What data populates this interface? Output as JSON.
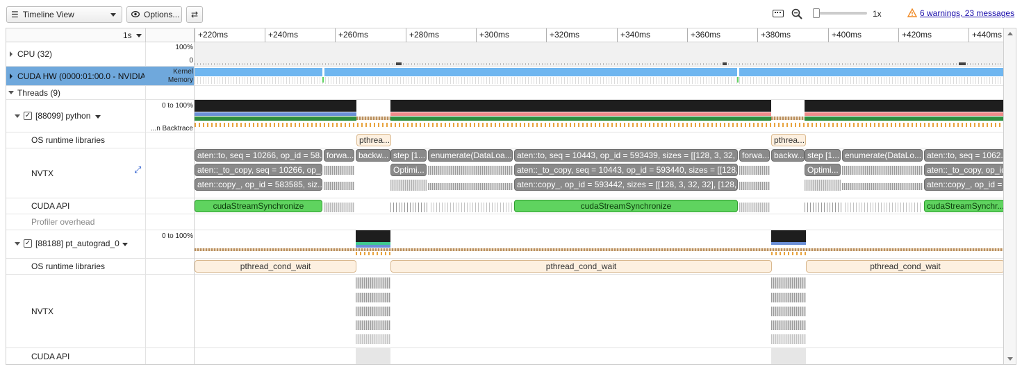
{
  "toolbar": {
    "view_select": "Timeline View",
    "options_label": "Options...",
    "swap_glyph": "⇄",
    "zoom_level": "1x",
    "warnings_link": "6 warnings, 23 messages"
  },
  "zoom_slider": {
    "value_fraction": 0.0
  },
  "timeline": {
    "scale_label": "1s",
    "ticks": [
      "+220ms",
      "+240ms",
      "+260ms",
      "+280ms",
      "+300ms",
      "+320ms",
      "+340ms",
      "+360ms",
      "+380ms",
      "+400ms",
      "+420ms",
      "+440ms"
    ]
  },
  "rows": {
    "cpu": {
      "label": "CPU (32)",
      "max": "100%",
      "min": "0"
    },
    "cuda_hw": {
      "label": "CUDA HW (0000:01:00.0 - NVIDIA (",
      "kernel": "Kernel",
      "memory": "Memory"
    },
    "threads": {
      "label": "Threads (9)"
    },
    "python": {
      "label": "[88099] python",
      "range": "0 to 100%",
      "backtrace": "...n Backtrace"
    },
    "python_os": {
      "label": "OS runtime libraries"
    },
    "python_nvtx": {
      "label": "NVTX"
    },
    "python_cuda": {
      "label": "CUDA API"
    },
    "profiler": {
      "label": "Profiler overhead"
    },
    "autograd": {
      "label": "[88188] pt_autograd_0",
      "range": "0 to 100%"
    },
    "autograd_os": {
      "label": "OS runtime libraries"
    },
    "autograd_nvtx": {
      "label": "NVTX"
    },
    "autograd_cuda": {
      "label": "CUDA API"
    }
  },
  "events": {
    "os_python": [
      "pthrea...",
      "pthrea..."
    ],
    "nvtx_row1": [
      "aten::to, seq = 10266, op_id = 58...",
      "forwa...",
      "backw...",
      "step [1...",
      "enumerate(DataLoa...",
      "aten::to, seq = 10443, op_id = 593439, sizes = [[128, 3, 32, ...",
      "forwa...",
      "backw...",
      "step [1...",
      "enumerate(DataLo...",
      "aten::to, seq = 1062..."
    ],
    "nvtx_row2": [
      "aten::_to_copy, seq = 10266, op_...",
      "Optimi...",
      "aten::_to_copy, seq = 10443, op_id = 593440, sizes = [[128,...",
      "Optimi...",
      "aten::_to_copy, op_id = ..."
    ],
    "nvtx_row3": [
      "aten::copy_, op_id = 583585, siz...",
      "aten::copy_, op_id = 593442, sizes = [[128, 3, 32, 32], [128, ...",
      "aten::copy_, op_id = ..."
    ],
    "cuda_python": [
      "cudaStreamSynchronize",
      "cudaStreamSynchronize",
      "cudaStreamSynchr..."
    ],
    "os_autograd": [
      "pthread_cond_wait",
      "pthread_cond_wait",
      "pthread_cond_wait"
    ]
  },
  "colors": {
    "kernel": "#6fb6f0",
    "cuda_api": "#5fd35f",
    "python_red": "#f08a8a",
    "python_blue": "#6b8fd6",
    "nvtx": "#8a8a8a",
    "os_runtime": "#fdf0e0",
    "warning": "#f08a24",
    "link": "#1a0dab"
  },
  "icons": [
    "hamburger-icon",
    "eye-icon",
    "swap-icon",
    "keyboard-icon",
    "zoom-out-icon",
    "warning-icon",
    "expand-icon"
  ]
}
